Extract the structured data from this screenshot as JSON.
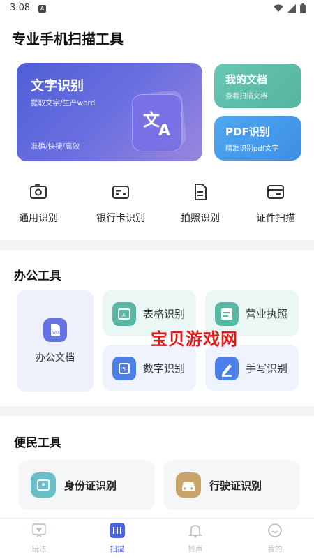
{
  "status": {
    "time": "3:08",
    "badge": "A"
  },
  "header": {
    "title": "专业手机扫描工具"
  },
  "hero": {
    "title": "文字识别",
    "subtitle": "提取文字/生产word",
    "tags": "准确/快捷/高效"
  },
  "cards": {
    "my_docs": {
      "title": "我的文档",
      "subtitle": "查看扫描文档"
    },
    "pdf": {
      "title": "PDF识别",
      "subtitle": "精准识别pdf文字"
    }
  },
  "quick": [
    {
      "label": "通用识别",
      "icon": "camera-icon"
    },
    {
      "label": "银行卡识别",
      "icon": "bank-card-icon"
    },
    {
      "label": "拍照识别",
      "icon": "document-icon"
    },
    {
      "label": "证件扫描",
      "icon": "id-card-icon"
    }
  ],
  "office": {
    "title": "办公工具",
    "big": {
      "label": "办公文档",
      "icon": "word-doc-icon"
    },
    "tiles": [
      {
        "label": "表格识别",
        "icon": "table-icon"
      },
      {
        "label": "营业执照",
        "icon": "license-icon"
      },
      {
        "label": "数字识别",
        "icon": "number-icon"
      },
      {
        "label": "手写识别",
        "icon": "pen-icon"
      }
    ]
  },
  "civil": {
    "title": "便民工具",
    "items": [
      {
        "label": "身份证识别",
        "icon": "id-card-icon"
      },
      {
        "label": "行驶证识别",
        "icon": "car-icon"
      }
    ]
  },
  "watermark": "宝贝游戏网",
  "tabs": [
    {
      "label": "玩法",
      "icon": "chat-heart-icon"
    },
    {
      "label": "扫描",
      "icon": "scan-icon"
    },
    {
      "label": "铃声",
      "icon": "bell-icon"
    },
    {
      "label": "我的",
      "icon": "smile-icon"
    }
  ],
  "colors": {
    "accent": "#4c63e6",
    "green": "#5dbba6",
    "blue": "#3e8fe6",
    "red_watermark": "#e01818"
  }
}
